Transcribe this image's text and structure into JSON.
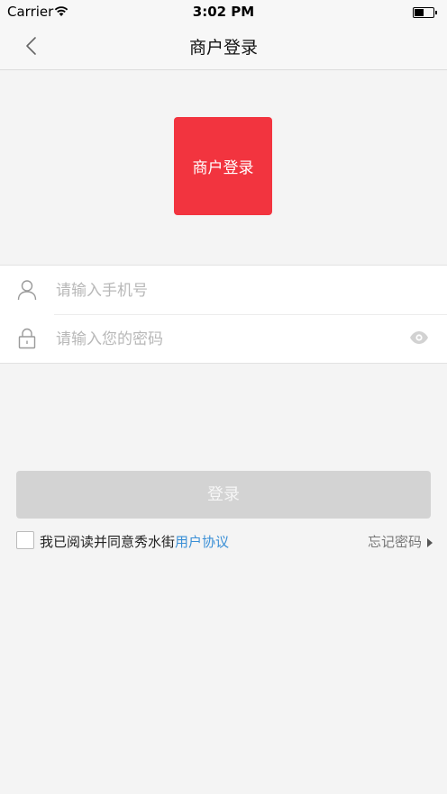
{
  "status_bar": {
    "carrier": "Carrier",
    "time": "3:02 PM"
  },
  "nav": {
    "title": "商户登录",
    "back_icon": "chevron-left-icon"
  },
  "logo": {
    "text": "商户登录",
    "color": "#f2343f"
  },
  "form": {
    "phone_placeholder": "请输入手机号",
    "password_placeholder": "请输入您的密码",
    "phone_icon": "user-icon",
    "password_icon": "lock-icon",
    "visibility_icon": "eye-icon"
  },
  "login_button": {
    "label": "登录",
    "color": "#d3d3d3"
  },
  "agreement": {
    "text": "我已阅读并同意秀水街",
    "link_text": "用户协议",
    "link_color": "#3a8fd6"
  },
  "forgot_password": {
    "label": "忘记密码"
  }
}
